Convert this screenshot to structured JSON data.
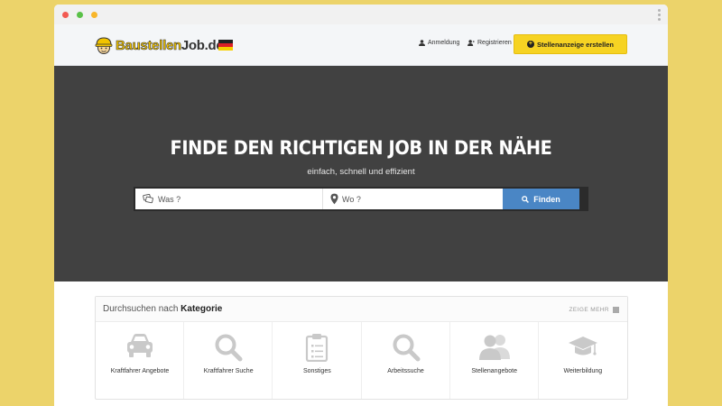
{
  "window": {
    "controls": [
      "close",
      "minimize",
      "maximize"
    ]
  },
  "header": {
    "logo": {
      "part_a": "Baustellen",
      "part_b": "Job.de",
      "helmet_icon": "helmet-icon"
    },
    "language_flag": "germany-flag",
    "nav": {
      "login": "Anmeldung",
      "register": "Registrieren"
    },
    "cta_label": "Stellenanzeige erstellen"
  },
  "hero": {
    "title": "FINDE DEN RICHTIGEN JOB IN DER NÄHE",
    "subtitle": "einfach, schnell und effizient",
    "search": {
      "what_placeholder": "Was ?",
      "where_placeholder": "Wo ?",
      "button_label": "Finden"
    }
  },
  "categories": {
    "title_prefix": "Durchsuchen nach",
    "title_strong": "Kategorie",
    "show_more": "ZEIGE MEHR",
    "items": [
      {
        "label": "Kraftfahrer Angebote",
        "icon": "car-icon"
      },
      {
        "label": "Kraftfahrer Suche",
        "icon": "search-icon"
      },
      {
        "label": "Sonstiges",
        "icon": "clipboard-icon"
      },
      {
        "label": "Arbeitssuche",
        "icon": "search-icon"
      },
      {
        "label": "Stellenangebote",
        "icon": "users-icon"
      },
      {
        "label": "Weiterbildung",
        "icon": "graduation-cap-icon"
      }
    ]
  },
  "colors": {
    "background": "#ecd36a",
    "hero": "#414141",
    "cta": "#f6d323",
    "search_button": "#4a86c5"
  }
}
